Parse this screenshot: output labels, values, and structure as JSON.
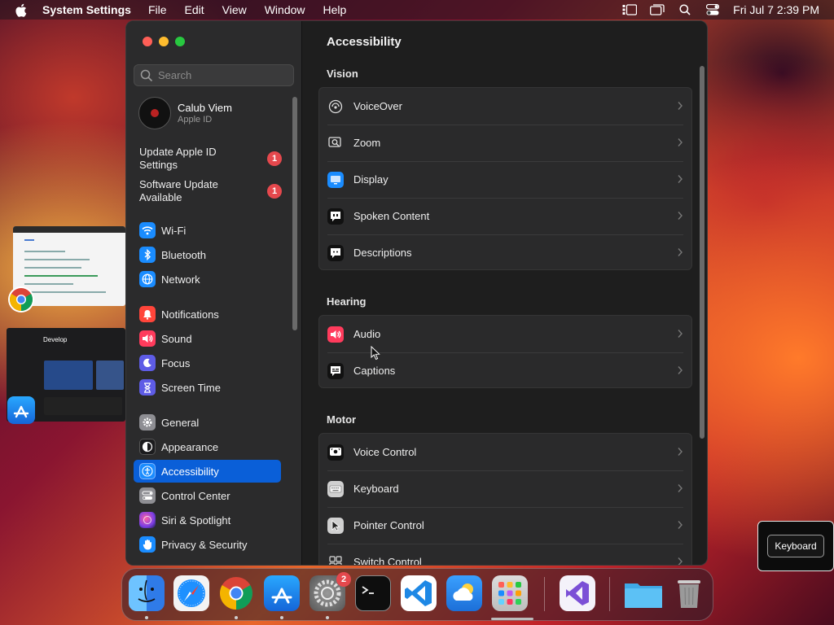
{
  "menubar": {
    "app_name": "System Settings",
    "menus": [
      "File",
      "Edit",
      "View",
      "Window",
      "Help"
    ],
    "clock": "Fri Jul 7  2:39 PM"
  },
  "window": {
    "search": {
      "placeholder": "Search",
      "value": ""
    },
    "user": {
      "name": "Calub Viem",
      "subtitle": "Apple ID"
    },
    "notices": [
      {
        "label": "Update Apple ID Settings",
        "badge": "1"
      },
      {
        "label": "Software Update Available",
        "badge": "1"
      }
    ],
    "sidebar": {
      "items": [
        {
          "label": "Wi-Fi",
          "icon": "wifi-icon",
          "color": "#1a8cff"
        },
        {
          "label": "Bluetooth",
          "icon": "bluetooth-icon",
          "color": "#1a8cff"
        },
        {
          "label": "Network",
          "icon": "globe-icon",
          "color": "#1a8cff"
        },
        {
          "label": "Notifications",
          "icon": "bell-icon",
          "color": "#ff453a"
        },
        {
          "label": "Sound",
          "icon": "speaker-icon",
          "color": "#ff3b5c"
        },
        {
          "label": "Focus",
          "icon": "moon-icon",
          "color": "#5e5ce6"
        },
        {
          "label": "Screen Time",
          "icon": "hourglass-icon",
          "color": "#5e5ce6"
        },
        {
          "label": "General",
          "icon": "gear-icon",
          "color": "#8e8e93"
        },
        {
          "label": "Appearance",
          "icon": "appearance-icon",
          "color": "#1c1c1e"
        },
        {
          "label": "Accessibility",
          "icon": "accessibility-icon",
          "color": "#1a8cff"
        },
        {
          "label": "Control Center",
          "icon": "control-center-icon",
          "color": "#8e8e93"
        },
        {
          "label": "Siri & Spotlight",
          "icon": "siri-icon",
          "color": "#b44bd8"
        },
        {
          "label": "Privacy & Security",
          "icon": "hand-icon",
          "color": "#1a8cff"
        }
      ],
      "selected": "Accessibility"
    },
    "main": {
      "title": "Accessibility",
      "sections": [
        {
          "heading": "Vision",
          "rows": [
            {
              "label": "VoiceOver",
              "icon": "voiceover-icon"
            },
            {
              "label": "Zoom",
              "icon": "zoom-icon"
            },
            {
              "label": "Display",
              "icon": "display-icon"
            },
            {
              "label": "Spoken Content",
              "icon": "spoken-content-icon"
            },
            {
              "label": "Descriptions",
              "icon": "descriptions-icon"
            }
          ]
        },
        {
          "heading": "Hearing",
          "rows": [
            {
              "label": "Audio",
              "icon": "audio-icon"
            },
            {
              "label": "Captions",
              "icon": "captions-icon"
            }
          ]
        },
        {
          "heading": "Motor",
          "rows": [
            {
              "label": "Voice Control",
              "icon": "voice-control-icon"
            },
            {
              "label": "Keyboard",
              "icon": "keyboard-icon"
            },
            {
              "label": "Pointer Control",
              "icon": "pointer-icon"
            },
            {
              "label": "Switch Control",
              "icon": "switch-control-icon"
            }
          ]
        }
      ]
    }
  },
  "tooltip": {
    "label": "Keyboard"
  },
  "stage": {
    "thumb2_title": "Develop"
  },
  "dock": {
    "apps": [
      {
        "name": "finder-icon"
      },
      {
        "name": "safari-icon"
      },
      {
        "name": "chrome-icon"
      },
      {
        "name": "app-store-icon"
      },
      {
        "name": "system-settings-icon",
        "badge": "2"
      },
      {
        "name": "terminal-icon"
      },
      {
        "name": "vscode-icon"
      },
      {
        "name": "weather-icon"
      },
      {
        "name": "launchpad-icon"
      },
      {
        "name": "visual-studio-icon"
      },
      {
        "name": "downloads-folder-icon"
      },
      {
        "name": "trash-icon"
      }
    ]
  }
}
